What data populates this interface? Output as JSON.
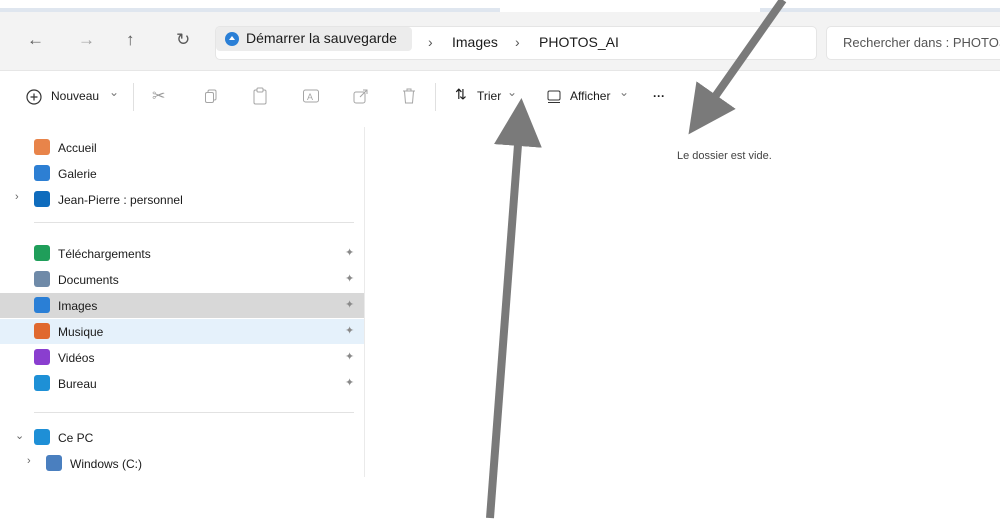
{
  "nav": {
    "back_icon": "←",
    "forward_icon": "→",
    "up_icon": "↑",
    "refresh_icon": "↻"
  },
  "breadcrumb": {
    "root": "Démarrer la sauvegarde",
    "sep1": "›",
    "item1": "Images",
    "sep2": "›",
    "item2": "PHOTOS_AI"
  },
  "search": {
    "placeholder": "Rechercher dans : PHOTOS_AI"
  },
  "toolbar": {
    "new_label": "Nouveau",
    "new_caret": "⌄",
    "sort_label": "Trier",
    "sort_caret": "⌄",
    "view_label": "Afficher",
    "view_caret": "⌄",
    "more_label": "···"
  },
  "sidebar": {
    "quick": [
      {
        "label": "Accueil",
        "icon": "home-icon",
        "color": "#e8844a"
      },
      {
        "label": "Galerie",
        "icon": "gallery-icon",
        "color": "#2d7fd3"
      },
      {
        "label": "Jean-Pierre : personnel",
        "icon": "cloud-icon",
        "color": "#0f6cbd"
      }
    ],
    "pinned": [
      {
        "label": "Téléchargements",
        "icon": "download-icon",
        "color": "#1f9e5a"
      },
      {
        "label": "Documents",
        "icon": "documents-icon",
        "color": "#6f8aa8"
      },
      {
        "label": "Images",
        "icon": "images-icon",
        "color": "#2a7fd6"
      },
      {
        "label": "Musique",
        "icon": "music-icon",
        "color": "#e0692f"
      },
      {
        "label": "Vidéos",
        "icon": "videos-icon",
        "color": "#8a3ecf"
      },
      {
        "label": "Bureau",
        "icon": "desktop-icon",
        "color": "#1e90d6"
      }
    ],
    "pc": [
      {
        "label": "Ce PC",
        "icon": "pc-icon",
        "color": "#1e8fd6"
      },
      {
        "label": "Windows (C:)",
        "icon": "drive-icon",
        "color": "#4a7fbf"
      }
    ],
    "pin_glyph": "📌"
  },
  "content": {
    "empty_text": "Le dossier est vide."
  },
  "colors": {
    "selected_row": "#d8d8d8",
    "hover_row": "#e5f1fb",
    "annotation_arrow": "#7a7a7a"
  }
}
